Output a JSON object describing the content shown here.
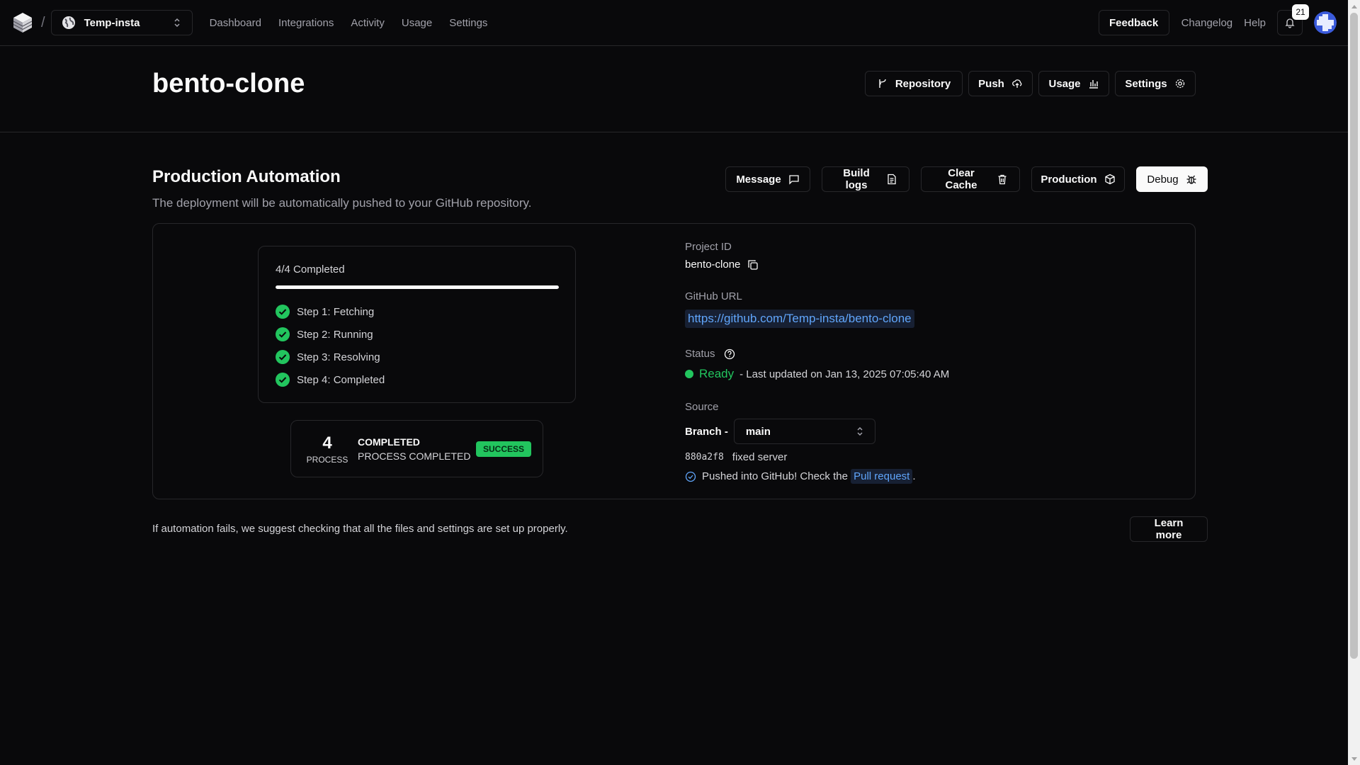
{
  "topbar": {
    "team_name": "Temp-insta",
    "separator": "/",
    "nav": [
      "Dashboard",
      "Integrations",
      "Activity",
      "Usage",
      "Settings"
    ],
    "feedback_label": "Feedback",
    "changelog_label": "Changelog",
    "help_label": "Help",
    "notification_count": "21"
  },
  "header": {
    "title": "bento-clone",
    "actions": {
      "repository": "Repository",
      "push": "Push",
      "usage": "Usage",
      "settings": "Settings"
    }
  },
  "automation": {
    "title": "Production Automation",
    "description": "The deployment will be automatically pushed to your GitHub repository.",
    "actions": {
      "message": "Message",
      "build_logs": "Build logs",
      "clear_cache": "Clear Cache",
      "production": "Production",
      "debug": "Debug"
    },
    "progress": {
      "label": "4/4 Completed",
      "fraction": 1.0,
      "steps": [
        "Step 1: Fetching",
        "Step 2: Running",
        "Step 3: Resolving",
        "Step 4: Completed"
      ]
    },
    "summary": {
      "count": "4",
      "count_label": "PROCESS",
      "title": "COMPLETED",
      "subtitle": "PROCESS COMPLETED",
      "badge": "SUCCESS"
    },
    "details": {
      "project_id_label": "Project ID",
      "project_id": "bento-clone",
      "github_url_label": "GitHub URL",
      "github_url": "https://github.com/Temp-insta/bento-clone",
      "status_label": "Status",
      "status_value": "Ready",
      "status_meta": "- Last updated on Jan 13, 2025 07:05:40 AM",
      "source_label": "Source",
      "branch_label": "Branch -",
      "branch_value": "main",
      "commit_hash": "880a2f8",
      "commit_message": "fixed server",
      "push_note": "Pushed into GitHub! Check the",
      "pull_request_label": "Pull request",
      "push_note_end": "."
    }
  },
  "footer": {
    "note": "If automation fails, we suggest checking that all the files and settings are set up properly.",
    "learn_more": "Learn more"
  },
  "colors": {
    "background": "#09090b",
    "border": "#27272a",
    "success": "#22c55e",
    "link": "#60a5fa"
  }
}
